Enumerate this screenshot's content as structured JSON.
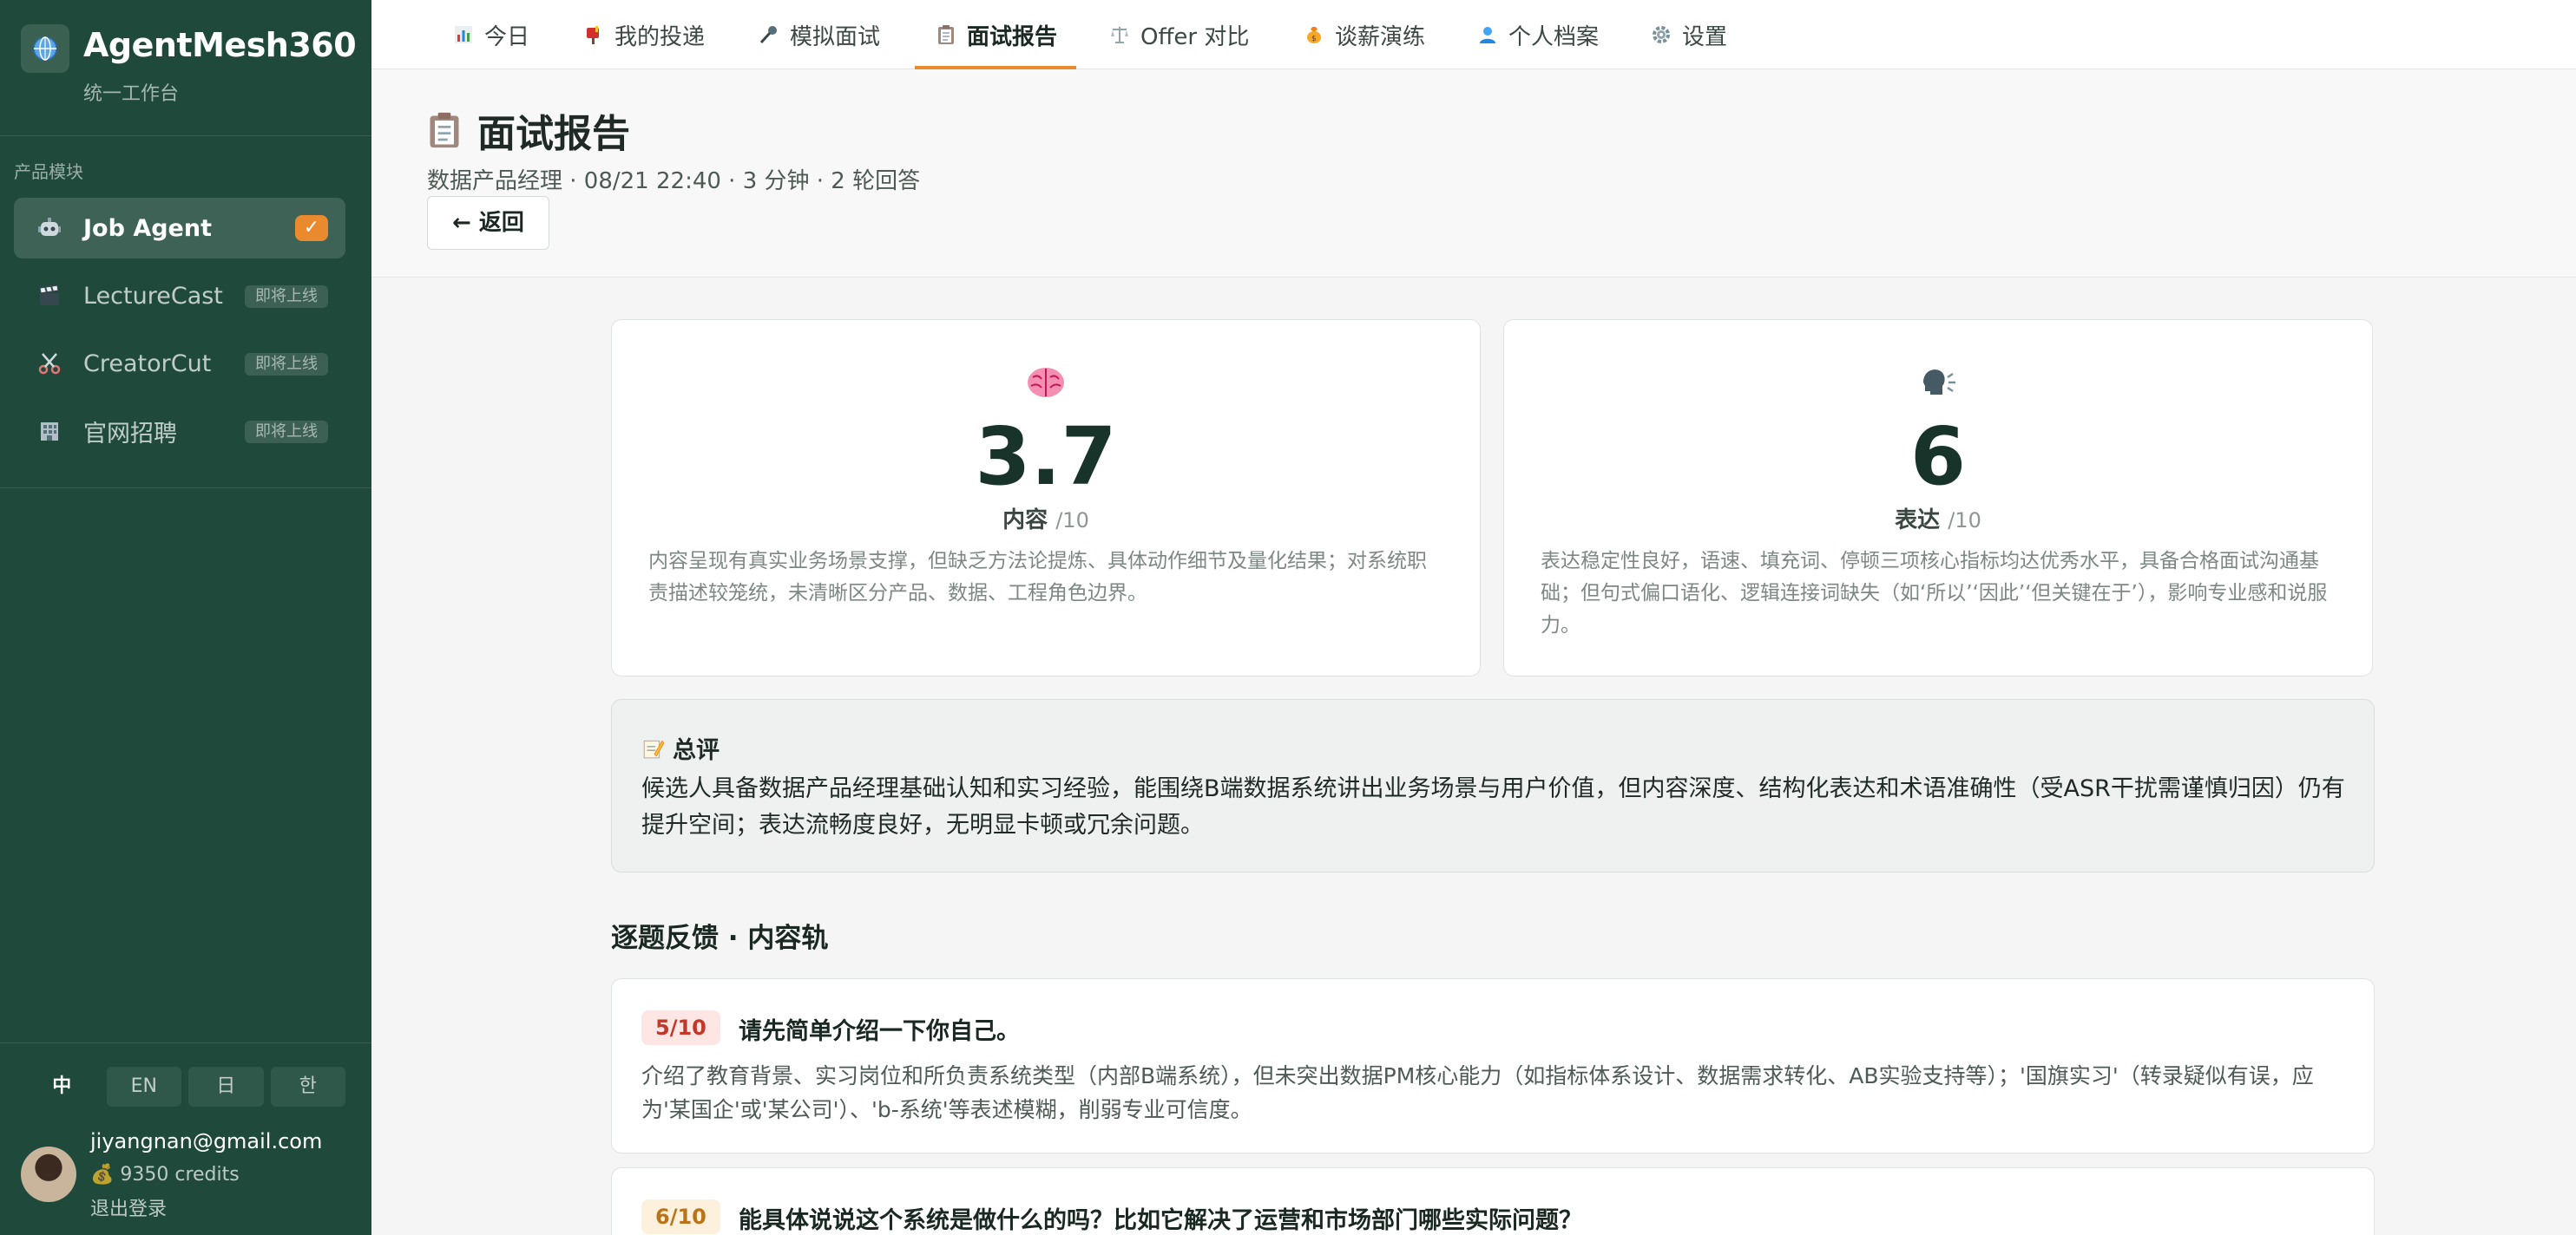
{
  "sidebar": {
    "brand_title": "AgentMesh360",
    "brand_subtitle": "统一工作台",
    "section_label": "产品模块",
    "items": [
      {
        "label": "Job Agent",
        "icon": "robot-icon",
        "active": true
      },
      {
        "label": "LectureCast",
        "icon": "clapper-icon",
        "badge": "即将上线"
      },
      {
        "label": "CreatorCut",
        "icon": "scissors-icon",
        "badge": "即将上线"
      },
      {
        "label": "官网招聘",
        "icon": "building-icon",
        "badge": "即将上线"
      }
    ],
    "active_check": "✓",
    "languages": [
      "中",
      "EN",
      "日",
      "한"
    ],
    "user": {
      "email": "jiyangnan@gmail.com",
      "credits": "💰 9350 credits",
      "logout": "退出登录"
    }
  },
  "tabs": [
    {
      "label": "今日",
      "icon": "bar-chart-icon"
    },
    {
      "label": "我的投递",
      "icon": "mailbox-icon"
    },
    {
      "label": "模拟面试",
      "icon": "microphone-icon"
    },
    {
      "label": "面试报告",
      "icon": "clipboard-icon",
      "active": true
    },
    {
      "label": "Offer 对比",
      "icon": "scales-icon"
    },
    {
      "label": "谈薪演练",
      "icon": "money-bag-icon"
    },
    {
      "label": "个人档案",
      "icon": "person-icon"
    },
    {
      "label": "设置",
      "icon": "gear-icon"
    }
  ],
  "header": {
    "title": "面试报告",
    "meta": "数据产品经理 · 08/21 22:40 · 3 分钟 · 2 轮回答",
    "back_label": "← 返回"
  },
  "scores": {
    "content": {
      "value": "3.7",
      "label": "内容",
      "max": "/10",
      "icon": "brain-icon",
      "desc": "内容呈现有真实业务场景支撑，但缺乏方法论提炼、具体动作细节及量化结果；对系统职责描述较笼统，未清晰区分产品、数据、工程角色边界。"
    },
    "expression": {
      "value": "6",
      "label": "表达",
      "max": "/10",
      "icon": "speaking-head-icon",
      "desc": "表达稳定性良好，语速、填充词、停顿三项核心指标均达优秀水平，具备合格面试沟通基础；但句式偏口语化、逻辑连接词缺失（如‘所以’‘因此’‘但关键在于’），影响专业感和说服力。"
    }
  },
  "summary": {
    "title": "总评",
    "icon": "memo-icon",
    "text": "候选人具备数据产品经理基础认知和实习经验，能围绕B端数据系统讲出业务场景与用户价值，但内容深度、结构化表达和术语准确性（受ASR干扰需谨慎归因）仍有提升空间；表达流畅度良好，无明显卡顿或冗余问题。"
  },
  "feedback": {
    "section_title": "逐题反馈 · 内容轨",
    "items": [
      {
        "score": "5/10",
        "question": "请先简单介绍一下你自己。",
        "feedback": "介绍了教育背景、实习岗位和所负责系统类型（内部B端系统），但未突出数据PM核心能力（如指标体系设计、数据需求转化、AB实验支持等）；'国旗实习'（转录疑似有误，应为'某国企'或'某公司'）、'b-系统'等表述模糊，削弱专业可信度。"
      },
      {
        "score": "6/10",
        "question": "能具体说说这个系统是做什么的吗？比如它解决了运营和市场部门哪些实际问题？",
        "feedback": ""
      }
    ]
  },
  "colors": {
    "sidebar_bg": "#1f4a3b",
    "accent": "#e98a2f",
    "score_red": "#c0392b",
    "score_orange": "#b8741b"
  }
}
